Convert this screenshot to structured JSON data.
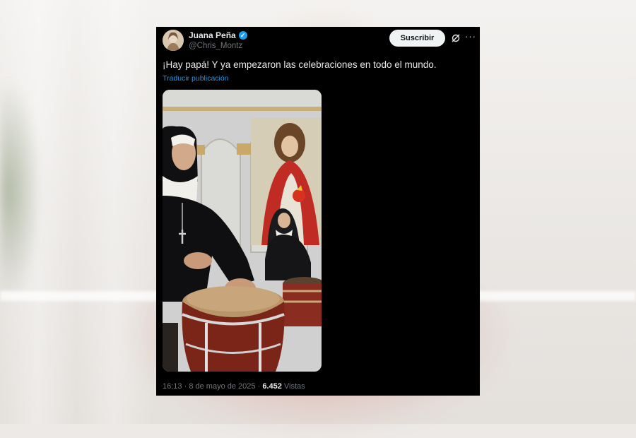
{
  "tweet": {
    "author_name": "Juana Peña",
    "author_handle": "@Chris_Montz",
    "subscribe_label": "Suscribir",
    "more_label": "···",
    "text": "¡Hay papá! Y ya empezaron las celebraciones en todo el mundo.",
    "translate_label": "Traducir publicación",
    "time": "16:13",
    "separator": "·",
    "date": "8 de mayo de 2025",
    "views_count": "6.452",
    "views_label": "Vistas"
  },
  "icons": {
    "verified": "verified-badge-icon",
    "grok": "grok-icon",
    "more": "more-options-icon"
  },
  "colors": {
    "card_bg": "#000000",
    "text_primary": "#e7e9ea",
    "text_secondary": "#71767b",
    "link": "#1d9bf0",
    "subscribe_bg": "#eff3f4"
  }
}
